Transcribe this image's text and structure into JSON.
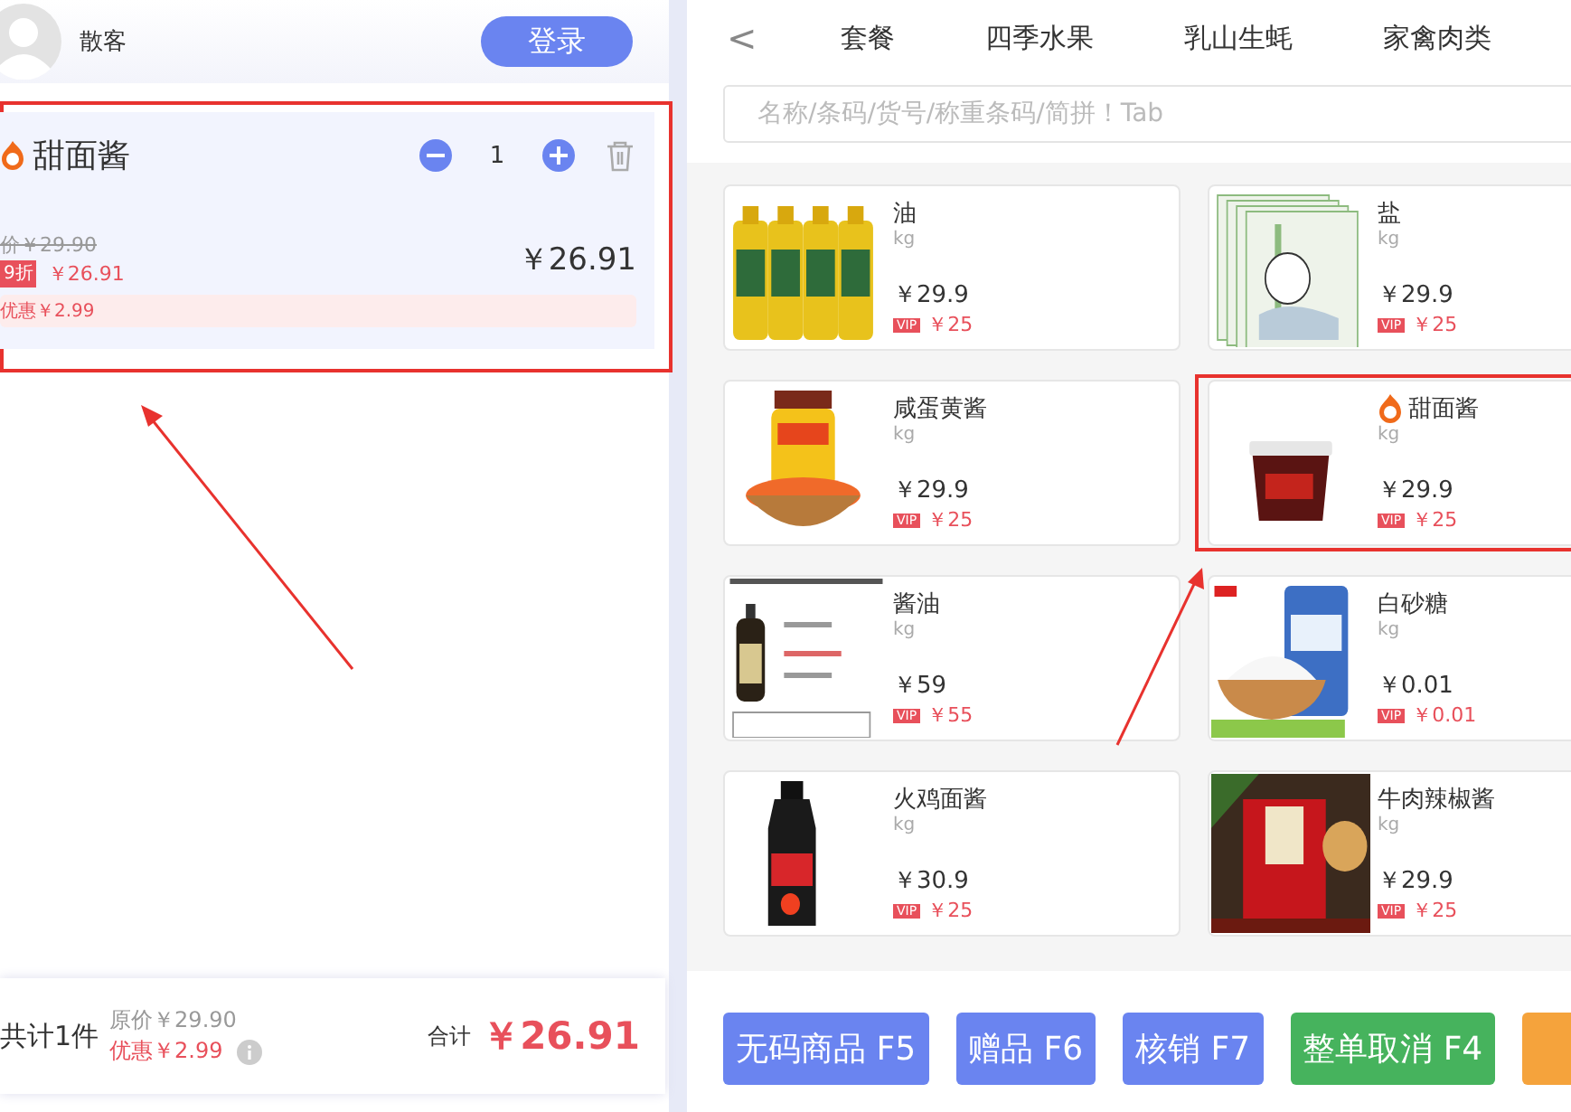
{
  "customer": {
    "name": "散客",
    "login_button": "登录"
  },
  "cart_items": [
    {
      "name": "甜面酱",
      "promo": true,
      "marked": true,
      "quantity": "1",
      "original_price": "价￥29.90",
      "discount_badge": "9折",
      "discount_price": "￥26.91",
      "total": "￥26.91",
      "saving": "优惠￥2.99"
    }
  ],
  "cart_summary": {
    "count": "共计1件",
    "original": "原价￥29.90",
    "saving": "优惠￥2.99",
    "total_label": "合计",
    "total": "￥26.91"
  },
  "category_tabs": [
    "套餐",
    "四季水果",
    "乳山生蚝",
    "家禽肉类"
  ],
  "back_icon": "<",
  "search": {
    "placeholder": "名称/条码/货号/称重条码/简拼！Tab"
  },
  "products": [
    {
      "name": "油",
      "unit": "kg",
      "price": "￥29.9",
      "vip_label": "VIP",
      "vip_price": "￥25",
      "promo": false,
      "marked": false
    },
    {
      "name": "盐",
      "unit": "kg",
      "price": "￥29.9",
      "vip_label": "VIP",
      "vip_price": "￥25",
      "promo": false,
      "marked": false
    },
    {
      "name": "咸蛋黄酱",
      "unit": "kg",
      "price": "￥29.9",
      "vip_label": "VIP",
      "vip_price": "￥25",
      "promo": false,
      "marked": false
    },
    {
      "name": "甜面酱",
      "unit": "kg",
      "price": "￥29.9",
      "vip_label": "VIP",
      "vip_price": "￥25",
      "promo": true,
      "marked": true
    },
    {
      "name": "酱油",
      "unit": "kg",
      "price": "￥59",
      "vip_label": "VIP",
      "vip_price": "￥55",
      "promo": false,
      "marked": false
    },
    {
      "name": "白砂糖",
      "unit": "kg",
      "price": "￥0.01",
      "vip_label": "VIP",
      "vip_price": "￥0.01",
      "promo": false,
      "marked": false
    },
    {
      "name": "火鸡面酱",
      "unit": "kg",
      "price": "￥30.9",
      "vip_label": "VIP",
      "vip_price": "￥25",
      "promo": false,
      "marked": false
    },
    {
      "name": "牛肉辣椒酱",
      "unit": "kg",
      "price": "￥29.9",
      "vip_label": "VIP",
      "vip_price": "￥25",
      "promo": false,
      "marked": false
    }
  ],
  "actions": [
    {
      "label": "无码商品 F5",
      "kind": "primary"
    },
    {
      "label": "赠品 F6",
      "kind": "primary"
    },
    {
      "label": "核销 F7",
      "kind": "primary"
    },
    {
      "label": "整单取消 F4",
      "kind": "success"
    },
    {
      "kind": "warning"
    }
  ]
}
